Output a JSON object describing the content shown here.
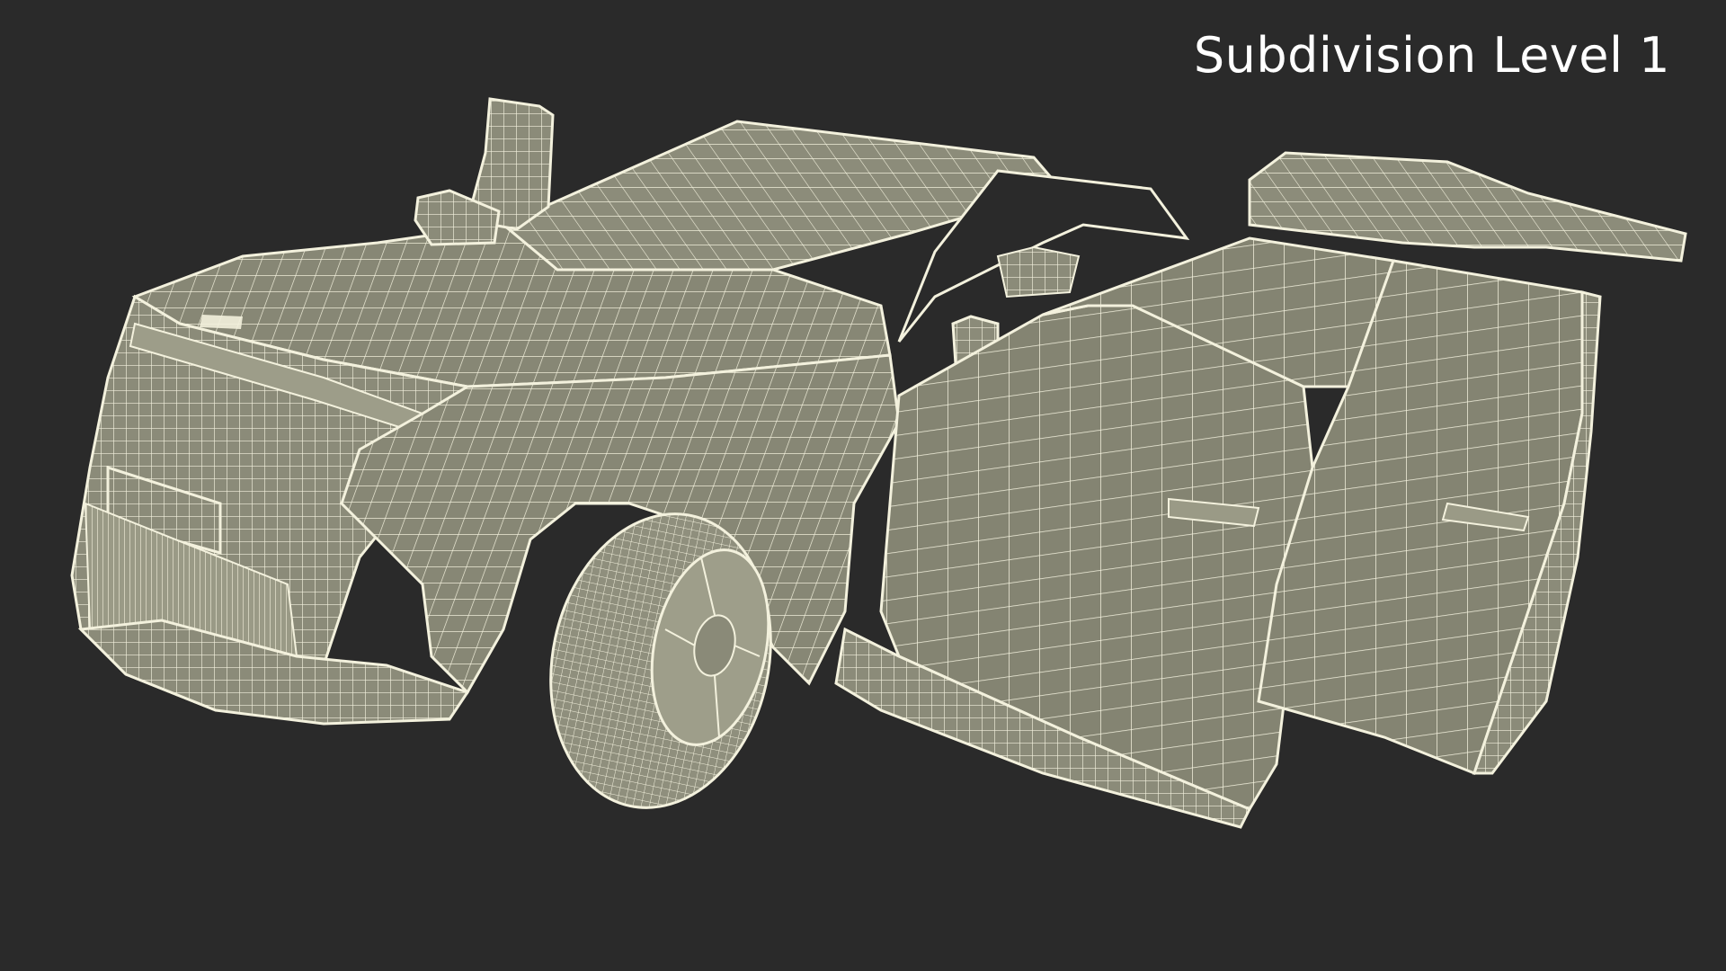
{
  "viewport": {
    "label": "Subdivision Level 1",
    "background_color": "#2a2a2a",
    "label_color": "#ffffff"
  },
  "model": {
    "subject": "wireframe-suv-doors-open",
    "surface_color": "#8a8a78",
    "wire_color": "#f2f0dc"
  }
}
